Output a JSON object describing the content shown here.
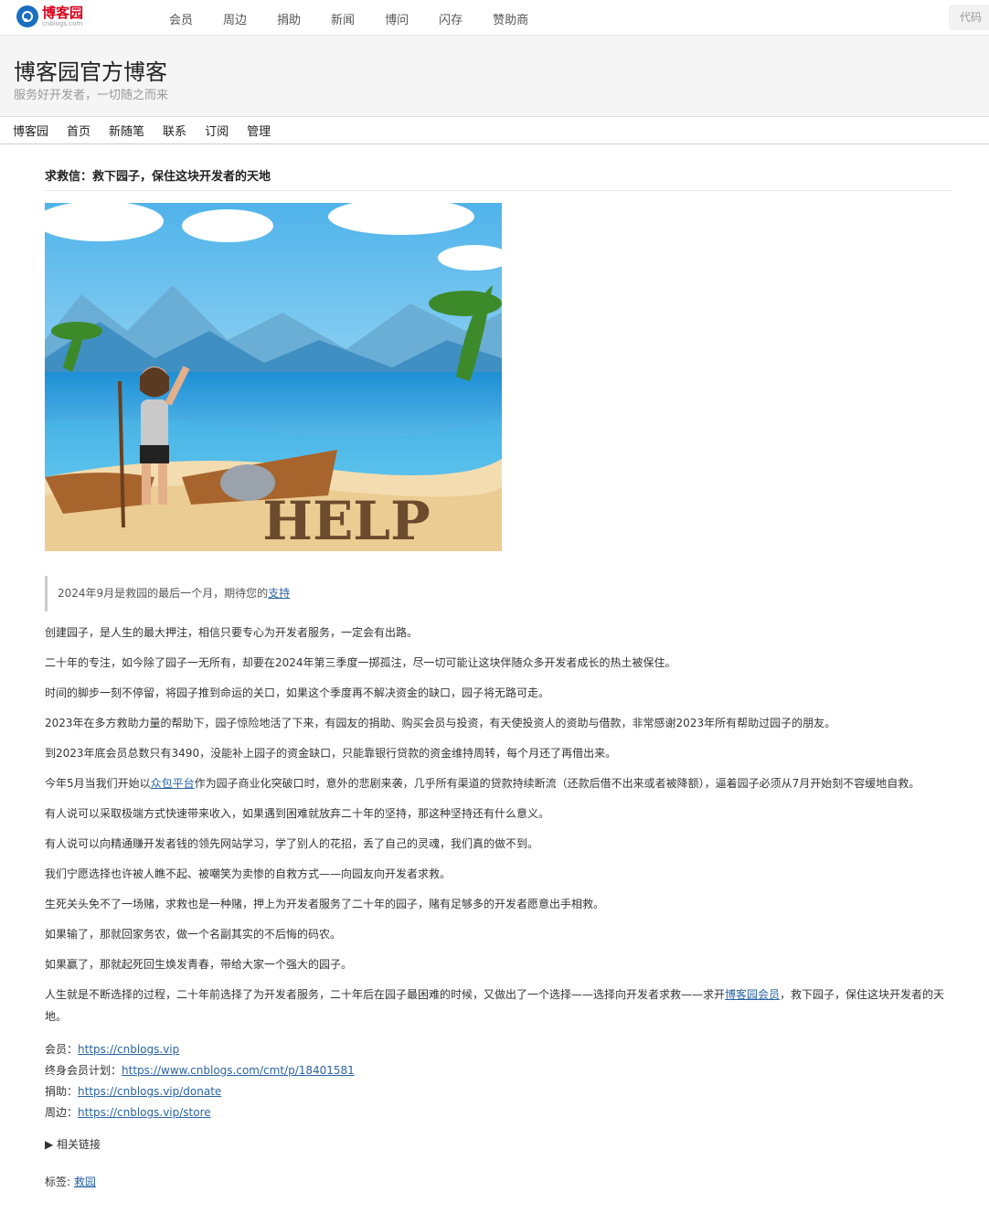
{
  "topbar": {
    "logo_cn": "博客园",
    "logo_en": "cnblogs.com",
    "nav": [
      "会员",
      "周边",
      "捐助",
      "新闻",
      "博问",
      "闪存",
      "赞助商"
    ],
    "search_placeholder": "代码"
  },
  "header": {
    "title": "博客园官方博客",
    "subtitle": "服务好开发者，一切随之而来"
  },
  "subnav": [
    "博客园",
    "首页",
    "新随笔",
    "联系",
    "订阅",
    "管理"
  ],
  "post": {
    "title": "求救信：救下园子，保住这块开发者的天地",
    "image_words": "HELP",
    "quote_text": "2024年9月是救园的最后一个月，期待您的",
    "quote_link": "支持",
    "paragraphs": [
      "创建园子，是人生的最大押注，相信只要专心为开发者服务，一定会有出路。",
      "二十年的专注，如今除了园子一无所有，却要在2024年第三季度一掷孤注，尽一切可能让这块伴随众多开发者成长的热土被保住。",
      "时间的脚步一刻不停留，将园子推到命运的关口，如果这个季度再不解决资金的缺口，园子将无路可走。",
      "2023年在多方救助力量的帮助下，园子惊险地活了下来，有园友的捐助、购买会员与投资，有天使投资人的资助与借款，非常感谢2023年所有帮助过园子的朋友。",
      "到2023年底会员总数只有3490，没能补上园子的资金缺口，只能靠银行贷款的资金维持周转，每个月还了再借出来。"
    ],
    "para6_before": "今年5月当我们开始以",
    "para6_link": "众包平台",
    "para6_after": "作为园子商业化突破口时，意外的悲剧来袭，几乎所有渠道的贷款持续断流（还款后借不出来或者被降额），逼着园子必须从7月开始刻不容缓地自救。",
    "paragraphs2": [
      "有人说可以采取极端方式快速带来收入，如果遇到困难就放弃二十年的坚持，那这种坚持还有什么意义。",
      "有人说可以向精通赚开发者钱的领先网站学习，学了别人的花招，丢了自己的灵魂，我们真的做不到。",
      "我们宁愿选择也许被人瞧不起、被嘲笑为卖惨的自救方式——向园友向开发者求救。",
      "生死关头免不了一场赌，求救也是一种赌，押上为开发者服务了二十年的园子，赌有足够多的开发者愿意出手相救。",
      "如果输了，那就回家务农，做一个名副其实的不后悔的码农。",
      "如果赢了，那就起死回生焕发青春，带给大家一个强大的园子。"
    ],
    "last_before": "人生就是不断选择的过程，二十年前选择了为开发者服务，二十年后在园子最困难的时候，又做出了一个选择——选择向开发者求救——求开",
    "last_link": "博客园会员",
    "last_after": "，救下园子，保住这块开发者的天地。",
    "links": [
      {
        "label": "会员：",
        "url": "https://cnblogs.vip"
      },
      {
        "label": "终身会员计划：",
        "url": "https://www.cnblogs.com/cmt/p/18401581"
      },
      {
        "label": "捐助：",
        "url": "https://cnblogs.vip/donate"
      },
      {
        "label": "周边：",
        "url": "https://cnblogs.vip/store"
      }
    ],
    "related": "▶ 相关链接",
    "tags_label": "标签:",
    "tag": "救园"
  }
}
